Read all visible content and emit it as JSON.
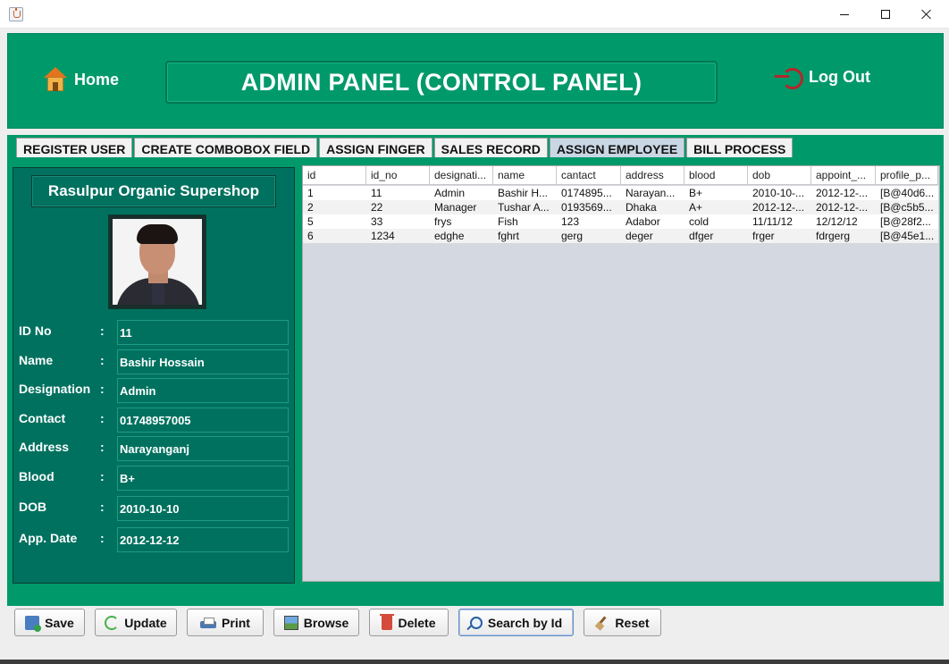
{
  "window": {
    "java_icon": "java-cup-icon"
  },
  "header": {
    "home_label": "Home",
    "title": "ADMIN PANEL (CONTROL PANEL)",
    "logout_label": "Log Out"
  },
  "tabs": [
    {
      "label": "REGISTER USER",
      "active": false
    },
    {
      "label": "CREATE COMBOBOX FIELD",
      "active": false
    },
    {
      "label": "ASSIGN FINGER",
      "active": false
    },
    {
      "label": "SALES RECORD",
      "active": false
    },
    {
      "label": "ASSIGN EMPLOYEE",
      "active": true
    },
    {
      "label": "BILL PROCESS",
      "active": false
    }
  ],
  "card": {
    "shop_name": "Rasulpur Organic Supershop",
    "fields": [
      {
        "label": "ID No",
        "colon": ":",
        "value": "11"
      },
      {
        "label": "Name",
        "colon": ":",
        "value": "Bashir Hossain"
      },
      {
        "label": "Designation",
        "colon": ":",
        "value": "Admin"
      },
      {
        "label": "Contact",
        "colon": ":",
        "value": "01748957005"
      },
      {
        "label": "Address",
        "colon": ":",
        "value": "Narayanganj"
      },
      {
        "label": "Blood",
        "colon": ":",
        "value": "B+"
      },
      {
        "label": "DOB",
        "colon": ":",
        "value": "2010-10-10"
      },
      {
        "label": "App. Date",
        "colon": ":",
        "value": "2012-12-12"
      }
    ]
  },
  "table": {
    "columns": [
      "id",
      "id_no",
      "designati...",
      "name",
      "cantact",
      "address",
      "blood",
      "dob",
      "appoint_...",
      "profile_p..."
    ],
    "rows": [
      [
        "1",
        "11",
        "Admin",
        "Bashir H...",
        "0174895...",
        "Narayan...",
        "B+",
        "2010-10-...",
        "2012-12-...",
        "[B@40d6..."
      ],
      [
        "2",
        "22",
        "Manager",
        "Tushar A...",
        "0193569...",
        "Dhaka",
        "A+",
        "2012-12-...",
        "2012-12-...",
        "[B@c5b5..."
      ],
      [
        "5",
        "33",
        "frys",
        "Fish",
        "123",
        "Adabor",
        "cold",
        "11/11/12",
        "12/12/12",
        "[B@28f2..."
      ],
      [
        "6",
        "1234",
        "edghe",
        "fghrt",
        "gerg",
        "deger",
        "dfger",
        "frger",
        "fdrgerg",
        "[B@45e1..."
      ]
    ]
  },
  "buttons": [
    {
      "label": "Save",
      "icon": "save-icon",
      "focused": false
    },
    {
      "label": "Update",
      "icon": "update-icon",
      "focused": false
    },
    {
      "label": "Print",
      "icon": "print-icon",
      "focused": false
    },
    {
      "label": "Browse",
      "icon": "browse-icon",
      "focused": false
    },
    {
      "label": "Delete",
      "icon": "delete-icon",
      "focused": false
    },
    {
      "label": "Search by Id",
      "icon": "search-icon",
      "focused": true
    },
    {
      "label": "Reset",
      "icon": "reset-icon",
      "focused": false
    }
  ],
  "colors": {
    "header_green": "#00996a",
    "card_teal": "#00715f",
    "active_tab": "#c9d7e5",
    "table_bg": "#d4d8e0"
  }
}
